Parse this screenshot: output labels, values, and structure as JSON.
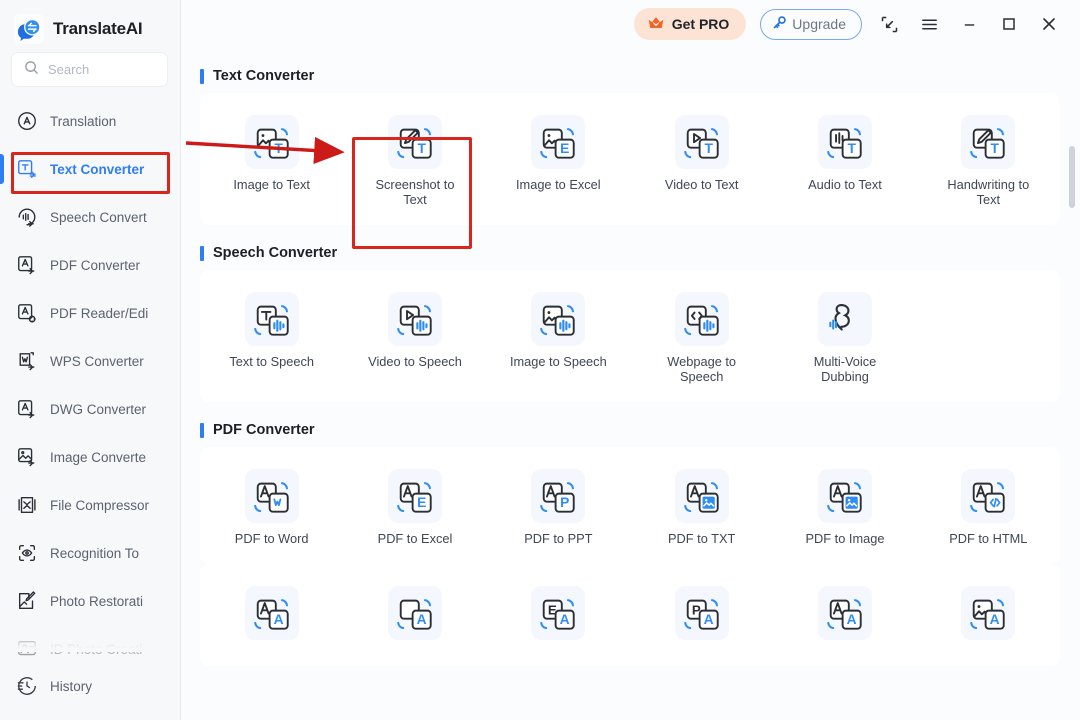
{
  "app": {
    "brand_name": "TranslateAI",
    "logo_icon": "translate-bubbles-logo"
  },
  "sidebar": {
    "search": {
      "placeholder": "Search",
      "value": "",
      "icon": "search-icon"
    },
    "items": [
      {
        "label": "Translation",
        "icon": "translation-icon",
        "active": false,
        "clipped": false
      },
      {
        "label": "Text Converter",
        "icon": "text-converter-icon",
        "active": true,
        "clipped": false
      },
      {
        "label": "Speech Convert",
        "icon": "speech-convert-icon",
        "active": false,
        "clipped": false
      },
      {
        "label": "PDF Converter",
        "icon": "pdf-converter-icon",
        "active": false,
        "clipped": false
      },
      {
        "label": "PDF Reader/Edi",
        "icon": "pdf-reader-edit-icon",
        "active": false,
        "clipped": false
      },
      {
        "label": "WPS Converter",
        "icon": "wps-converter-icon",
        "active": false,
        "clipped": false
      },
      {
        "label": "DWG Converter",
        "icon": "dwg-converter-icon",
        "active": false,
        "clipped": false
      },
      {
        "label": "Image Converte",
        "icon": "image-converter-icon",
        "active": false,
        "clipped": false
      },
      {
        "label": "File Compressor",
        "icon": "file-compressor-icon",
        "active": false,
        "clipped": false
      },
      {
        "label": "Recognition To",
        "icon": "recognition-icon",
        "active": false,
        "clipped": false
      },
      {
        "label": "Photo Restorati",
        "icon": "photo-restoration-icon",
        "active": false,
        "clipped": false
      },
      {
        "label": "ID Photo Creati",
        "icon": "id-photo-icon",
        "active": false,
        "clipped": true
      }
    ],
    "history": {
      "label": "History",
      "icon": "history-icon"
    }
  },
  "topbar": {
    "get_pro_label": "Get PRO",
    "get_pro_icon": "crown-icon",
    "upgrade_label": "Upgrade",
    "upgrade_icon": "key-icon",
    "window_buttons": [
      {
        "name": "collapse-icon"
      },
      {
        "name": "menu-icon"
      },
      {
        "name": "minimize-icon"
      },
      {
        "name": "maximize-icon"
      },
      {
        "name": "close-icon"
      }
    ]
  },
  "sections": [
    {
      "title": "Text Converter",
      "cards": [
        {
          "label": "Image to Text",
          "icon": "image-to-text-icon"
        },
        {
          "label": "Screenshot to Text",
          "icon": "screenshot-to-text-icon"
        },
        {
          "label": "Image to Excel",
          "icon": "image-to-excel-icon"
        },
        {
          "label": "Video to Text",
          "icon": "video-to-text-icon"
        },
        {
          "label": "Audio to Text",
          "icon": "audio-to-text-icon"
        },
        {
          "label": "Handwriting to Text",
          "icon": "handwriting-to-text-icon"
        }
      ]
    },
    {
      "title": "Speech Converter",
      "cards": [
        {
          "label": "Text to Speech",
          "icon": "text-to-speech-icon"
        },
        {
          "label": "Video to Speech",
          "icon": "video-to-speech-icon"
        },
        {
          "label": "Image to Speech",
          "icon": "image-to-speech-icon"
        },
        {
          "label": "Webpage to Speech",
          "icon": "webpage-to-speech-icon"
        },
        {
          "label": "Multi-Voice Dubbing",
          "icon": "multi-voice-dubbing-icon"
        }
      ]
    },
    {
      "title": "PDF Converter",
      "cards": [
        {
          "label": "PDF to Word",
          "icon": "pdf-to-word-icon"
        },
        {
          "label": "PDF to Excel",
          "icon": "pdf-to-excel-icon"
        },
        {
          "label": "PDF to PPT",
          "icon": "pdf-to-ppt-icon"
        },
        {
          "label": "PDF to TXT",
          "icon": "pdf-to-txt-icon"
        },
        {
          "label": "PDF to Image",
          "icon": "pdf-to-image-icon"
        },
        {
          "label": "PDF to HTML",
          "icon": "pdf-to-html-icon"
        }
      ]
    },
    {
      "title": "",
      "partial": true,
      "cards": [
        {
          "label": "",
          "icon": "txt-to-pdf-icon"
        },
        {
          "label": "",
          "icon": "word-to-pdf-icon"
        },
        {
          "label": "",
          "icon": "excel-to-pdf-icon"
        },
        {
          "label": "",
          "icon": "ppt-to-pdf-icon"
        },
        {
          "label": "",
          "icon": "text-to-pdf-icon"
        },
        {
          "label": "",
          "icon": "image-to-pdf-icon"
        }
      ]
    }
  ],
  "annotations": {
    "highlight_color": "#d8261c",
    "arrow_color": "#cc1a18",
    "highlighted_sidebar_item": "Text Converter",
    "highlighted_card": "Screenshot to Text"
  },
  "colors": {
    "accent": "#2f7df6",
    "sidebar_bg": "#f7f8fa",
    "page_bg": "#fbfcfd",
    "card_bg": "#ffffff",
    "pro_bg": "#fde3d4"
  },
  "scrollbar": {
    "thumb_visible": true
  }
}
